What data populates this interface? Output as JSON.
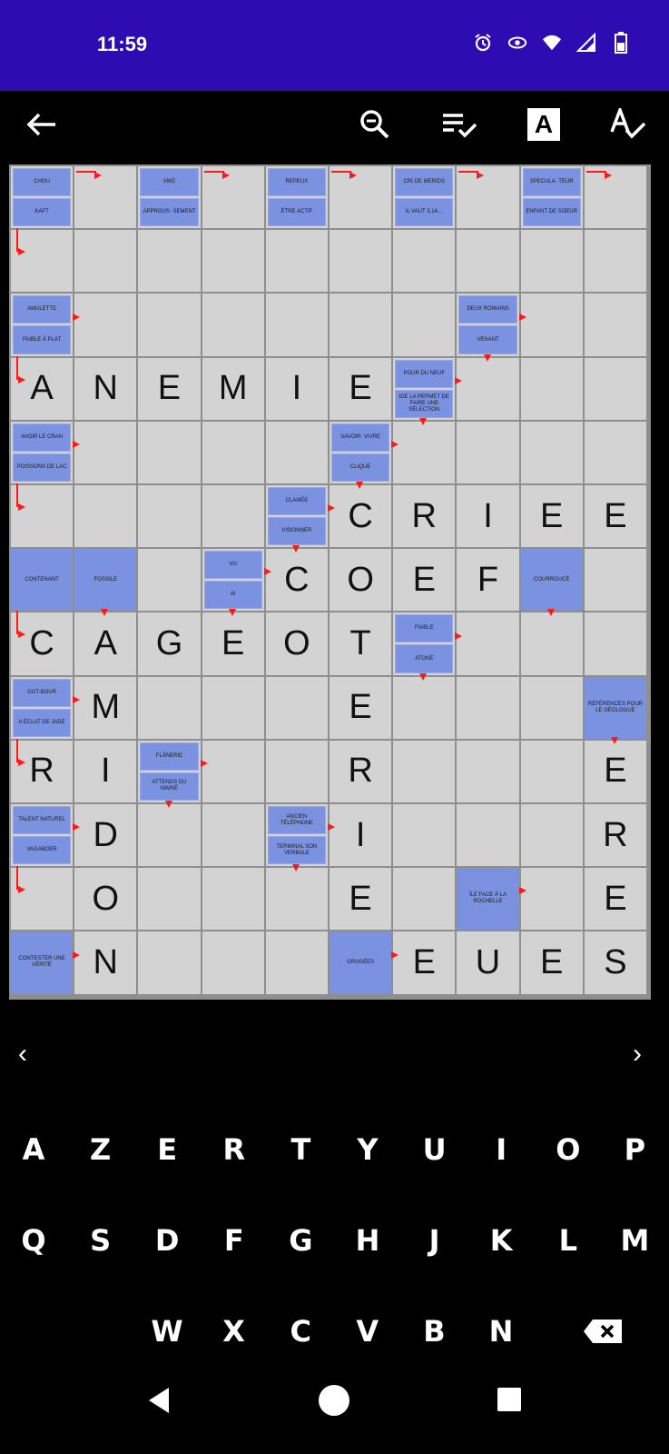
{
  "status": {
    "time": "11:59"
  },
  "toolbar": {
    "icons": [
      "back-arrow-icon",
      "zoom-out-icon",
      "checklist-icon",
      "letter-a-icon",
      "spell-check-icon"
    ],
    "letter_icon_text": "A"
  },
  "grid": {
    "rows": [
      [
        {
          "t": "clue2",
          "c": [
            "CHOU",
            "KAFT"
          ]
        },
        {
          "t": "empty"
        },
        {
          "t": "clue2",
          "c": [
            "VIKE",
            "APPROUS- SEMENT"
          ]
        },
        {
          "t": "empty"
        },
        {
          "t": "clue2",
          "c": [
            "REPEUX",
            "ÉTRE ACTIF"
          ]
        },
        {
          "t": "empty"
        },
        {
          "t": "clue2",
          "c": [
            "CRI DE MERIDS",
            "IL VAUT 3,14…"
          ]
        },
        {
          "t": "empty"
        },
        {
          "t": "clue2",
          "c": [
            "SPECULA- TEUR",
            "ENFANT DE SOEUR"
          ]
        },
        {
          "t": "empty"
        }
      ],
      [
        {
          "t": "empty"
        },
        {
          "t": "empty"
        },
        {
          "t": "empty"
        },
        {
          "t": "empty"
        },
        {
          "t": "empty"
        },
        {
          "t": "empty"
        },
        {
          "t": "empty"
        },
        {
          "t": "empty"
        },
        {
          "t": "empty"
        },
        {
          "t": "empty"
        }
      ],
      [
        {
          "t": "clue2",
          "c": [
            "AMULETTE",
            "FAIBLE À PLAT"
          ]
        },
        {
          "t": "empty"
        },
        {
          "t": "empty"
        },
        {
          "t": "empty"
        },
        {
          "t": "empty"
        },
        {
          "t": "empty"
        },
        {
          "t": "empty"
        },
        {
          "t": "clue2",
          "c": [
            "DEUX ROMAINS",
            "VENANT"
          ]
        },
        {
          "t": "empty"
        },
        {
          "t": "empty"
        }
      ],
      [
        {
          "t": "letter",
          "l": "A"
        },
        {
          "t": "letter",
          "l": "N"
        },
        {
          "t": "letter",
          "l": "E"
        },
        {
          "t": "letter",
          "l": "M"
        },
        {
          "t": "letter",
          "l": "I"
        },
        {
          "t": "letter",
          "l": "E"
        },
        {
          "t": "clue2",
          "c": [
            "POUR DU NEUF",
            "IDE LA PERMET DE FAIRE UNE SÉLECTION"
          ]
        },
        {
          "t": "empty"
        },
        {
          "t": "empty"
        },
        {
          "t": "empty"
        }
      ],
      [
        {
          "t": "clue2",
          "c": [
            "AVOIR LE CRAN",
            "POISSONS DE LAC"
          ]
        },
        {
          "t": "empty"
        },
        {
          "t": "empty"
        },
        {
          "t": "empty"
        },
        {
          "t": "empty"
        },
        {
          "t": "clue2",
          "c": [
            "SAVOIR- VIVRE",
            "CLIQUE"
          ]
        },
        {
          "t": "empty"
        },
        {
          "t": "empty"
        },
        {
          "t": "empty"
        },
        {
          "t": "empty"
        }
      ],
      [
        {
          "t": "empty"
        },
        {
          "t": "empty"
        },
        {
          "t": "empty"
        },
        {
          "t": "empty"
        },
        {
          "t": "clue2",
          "c": [
            "CLAMÉE",
            "VISIONNER"
          ]
        },
        {
          "t": "letter",
          "l": "C"
        },
        {
          "t": "letter",
          "l": "R"
        },
        {
          "t": "letter",
          "l": "I"
        },
        {
          "t": "letter",
          "l": "E"
        },
        {
          "t": "letter",
          "l": "E"
        }
      ],
      [
        {
          "t": "clue1",
          "c": [
            "CONTENANT"
          ]
        },
        {
          "t": "clue1",
          "c": [
            "FOSSILE"
          ]
        },
        {
          "t": "empty"
        },
        {
          "t": "clue2",
          "c": [
            "VU",
            "AI"
          ]
        },
        {
          "t": "letter",
          "l": "C"
        },
        {
          "t": "letter",
          "l": "O"
        },
        {
          "t": "letter",
          "l": "E"
        },
        {
          "t": "letter",
          "l": "F"
        },
        {
          "t": "clue1",
          "c": [
            "COURROUCÉ"
          ]
        },
        {
          "t": "empty"
        }
      ],
      [
        {
          "t": "letter",
          "l": "C"
        },
        {
          "t": "letter",
          "l": "A"
        },
        {
          "t": "letter",
          "l": "G"
        },
        {
          "t": "letter",
          "l": "E"
        },
        {
          "t": "letter",
          "l": "O"
        },
        {
          "t": "letter",
          "l": "T"
        },
        {
          "t": "clue2",
          "c": [
            "FIABLE",
            "ATONE"
          ]
        },
        {
          "t": "empty"
        },
        {
          "t": "empty"
        },
        {
          "t": "empty"
        }
      ],
      [
        {
          "t": "clue2",
          "c": [
            "GOT-BOUR",
            "A ÉCLAT DE JADE"
          ]
        },
        {
          "t": "letter",
          "l": "M"
        },
        {
          "t": "empty"
        },
        {
          "t": "empty"
        },
        {
          "t": "empty"
        },
        {
          "t": "letter",
          "l": "E"
        },
        {
          "t": "empty"
        },
        {
          "t": "empty"
        },
        {
          "t": "empty"
        },
        {
          "t": "clue1",
          "c": [
            "RÉFÉRENCES POUR LE GÉOLOGUE"
          ]
        }
      ],
      [
        {
          "t": "letter",
          "l": "R"
        },
        {
          "t": "letter",
          "l": "I"
        },
        {
          "t": "clue2",
          "c": [
            "FLÂNERIE",
            "ATTENDS DU MARIÉ"
          ]
        },
        {
          "t": "empty"
        },
        {
          "t": "empty"
        },
        {
          "t": "letter",
          "l": "R"
        },
        {
          "t": "empty"
        },
        {
          "t": "empty"
        },
        {
          "t": "empty"
        },
        {
          "t": "letter",
          "l": "E"
        }
      ],
      [
        {
          "t": "clue2",
          "c": [
            "TALENT NATUREL",
            "VAGABOER"
          ]
        },
        {
          "t": "letter",
          "l": "D"
        },
        {
          "t": "empty"
        },
        {
          "t": "empty"
        },
        {
          "t": "clue2",
          "c": [
            "ANCIEN TÉLÉPHONE",
            "TERMINAL SON VERBALE"
          ]
        },
        {
          "t": "letter",
          "l": "I"
        },
        {
          "t": "empty"
        },
        {
          "t": "empty"
        },
        {
          "t": "empty"
        },
        {
          "t": "letter",
          "l": "R"
        }
      ],
      [
        {
          "t": "empty"
        },
        {
          "t": "letter",
          "l": "O"
        },
        {
          "t": "empty"
        },
        {
          "t": "empty"
        },
        {
          "t": "empty"
        },
        {
          "t": "letter",
          "l": "E"
        },
        {
          "t": "empty"
        },
        {
          "t": "clue1",
          "c": [
            "ÎLE FACE À LA ROCHELLE"
          ]
        },
        {
          "t": "empty"
        },
        {
          "t": "letter",
          "l": "E"
        }
      ],
      [
        {
          "t": "clue1",
          "c": [
            "CONTESTER UNE VÉRITÉ"
          ]
        },
        {
          "t": "letter",
          "l": "N"
        },
        {
          "t": "empty"
        },
        {
          "t": "empty"
        },
        {
          "t": "empty"
        },
        {
          "t": "clue1",
          "c": [
            "GRUGÉES"
          ]
        },
        {
          "t": "letter",
          "l": "E"
        },
        {
          "t": "letter",
          "l": "U"
        },
        {
          "t": "letter",
          "l": "E"
        },
        {
          "t": "letter",
          "l": "S"
        }
      ]
    ]
  },
  "nav": {
    "prev": "‹",
    "next": "›"
  },
  "keyboard": {
    "row1": [
      "A",
      "Z",
      "E",
      "R",
      "T",
      "Y",
      "U",
      "I",
      "O",
      "P"
    ],
    "row2": [
      "Q",
      "S",
      "D",
      "F",
      "G",
      "H",
      "J",
      "K",
      "L",
      "M"
    ],
    "row3": [
      "W",
      "X",
      "C",
      "V",
      "B",
      "N"
    ]
  },
  "system_nav": [
    "back-triangle-icon",
    "home-circle-icon",
    "recents-square-icon"
  ]
}
